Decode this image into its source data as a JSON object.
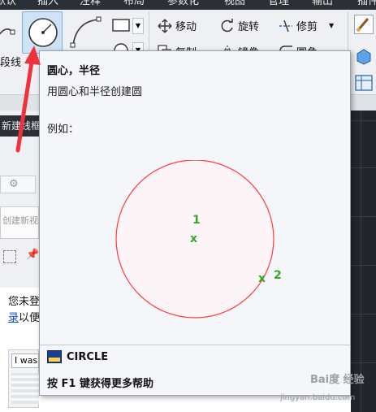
{
  "ribbon_tabs": [
    "默认",
    "插入",
    "注释",
    "布局",
    "参数化",
    "视图",
    "管理",
    "输出",
    "插件"
  ],
  "tools": {
    "polyline_label": "段线",
    "move": "移动",
    "rotate": "旋转",
    "trim": "修剪",
    "copy": "复制",
    "mirror": "镜像",
    "fillet": "圆角"
  },
  "panel_label": "绘",
  "file_tab": "新建线框",
  "left_pane": {
    "create_label": "创建新视",
    "text_line1": "您未登",
    "text_line2_link": "录",
    "text_line2_rest": "以便",
    "input_value": "I was"
  },
  "tooltip": {
    "title": "圆心，半径",
    "description": "用圆心和半径创建圆",
    "example_label": "例如：",
    "point1_label": "1",
    "point2_label": "2",
    "marker": "x",
    "command": "CIRCLE",
    "help": "按 F1 键获得更多帮助"
  },
  "watermark": {
    "brand": "Bai度 经验",
    "url": "jingyan.baidu.com"
  },
  "colors": {
    "circle_stroke": "#ff3b3b",
    "circle_fill": "#fdf4f8",
    "point_green": "#33aa22",
    "arrow_red": "#f0323c"
  }
}
